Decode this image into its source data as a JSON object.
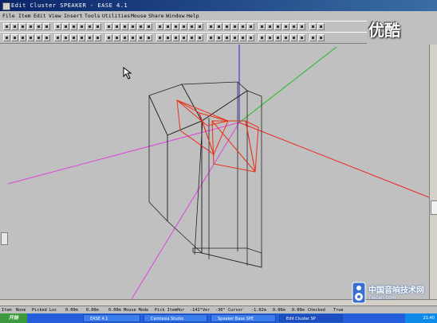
{
  "window": {
    "title": "Edit Cluster SPEAKER - EASE 4.1"
  },
  "menu": [
    "File",
    "Item",
    "Edit",
    "View",
    "Insert",
    "Tools",
    "Utilities",
    "Mouse",
    "Share",
    "Window",
    "Help"
  ],
  "logo_text": "优酷",
  "status": {
    "item_label": "Item",
    "item_value": "None",
    "picked_label": "Picked Loc",
    "x1": "0.00m",
    "y1": "0.00m",
    "z1": "0.00m",
    "mouse_mode_label": "Mouse Mode",
    "mouse_mode_value": "Pick Item",
    "hor_label": "Hor",
    "hor_value": "-141°",
    "ver_label": "Ver",
    "ver_value": "-30°",
    "cursor_label": "Cursor",
    "cx": "-1.02m",
    "cy": "0.06m",
    "cz": "0.00m",
    "checked_label": "Checked",
    "checked_value": "True"
  },
  "taskbar": {
    "start": "开始",
    "tasks": [
      "EASE 4.1",
      "Camtasia Studio",
      "Speaker Base SPE",
      "Edit Cluster SP"
    ],
    "clock": "21:40"
  },
  "watermark": {
    "text": "中国音响技术网",
    "url": "Tiecan.com"
  }
}
